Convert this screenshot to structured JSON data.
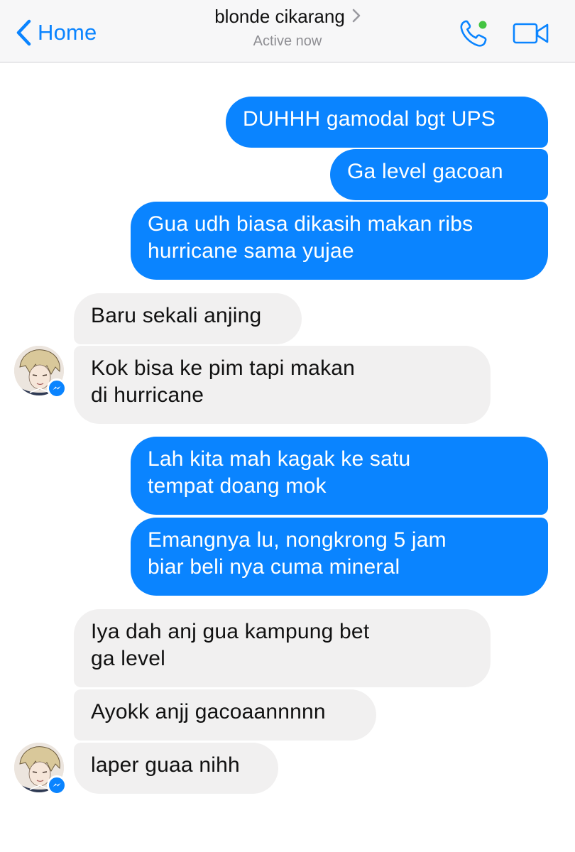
{
  "header": {
    "back_label": "Home",
    "contact_name": "blonde cikarang",
    "status": "Active now",
    "icons": {
      "back": "chevron-left-icon",
      "title_chevron": "chevron-right-icon",
      "call": "phone-icon",
      "video": "video-camera-icon"
    },
    "colors": {
      "accent": "#0a84ff",
      "online": "#44c442"
    }
  },
  "messages": [
    {
      "direction": "outgoing",
      "lines": [
        "DUHHH gamodal bgt UPS"
      ]
    },
    {
      "direction": "outgoing",
      "lines": [
        "Ga level gacoan"
      ]
    },
    {
      "direction": "outgoing",
      "lines": [
        "Gua udh biasa dikasih makan ribs",
        "hurricane sama yujae"
      ]
    },
    {
      "direction": "incoming",
      "lines": [
        "Baru sekali anjing"
      ]
    },
    {
      "direction": "incoming",
      "lines": [
        "Kok bisa ke pim tapi makan",
        "di hurricane"
      ]
    },
    {
      "direction": "outgoing",
      "lines": [
        "Lah kita mah kagak ke satu",
        "tempat doang mok"
      ]
    },
    {
      "direction": "outgoing",
      "lines": [
        "Emangnya lu, nongkrong 5 jam",
        "biar beli nya cuma mineral"
      ]
    },
    {
      "direction": "incoming",
      "lines": [
        "Iya dah anj gua kampung bet",
        "ga level"
      ]
    },
    {
      "direction": "incoming",
      "lines": [
        "Ayokk anjj gacoaannnnn"
      ]
    },
    {
      "direction": "incoming",
      "lines": [
        "laper guaa nihh"
      ]
    }
  ],
  "colors": {
    "outgoing_bubble": "#0a84ff",
    "incoming_bubble": "#f1f0f0"
  }
}
